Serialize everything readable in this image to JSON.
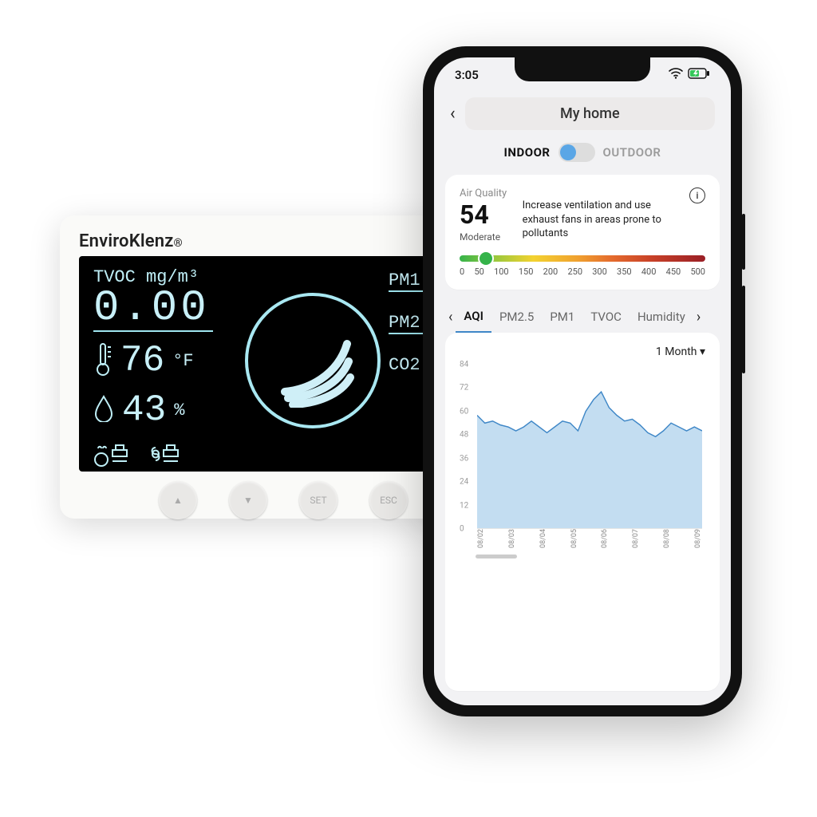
{
  "device": {
    "brand": "EnviroKlenz",
    "tvoc_label": "TVOC mg/m³",
    "tvoc_value": "0.00",
    "temp_value": "76",
    "temp_unit": "°F",
    "hum_value": "43",
    "hum_unit": "%",
    "pm1_label": "PM1.",
    "pm25_label": "PM2.",
    "co2_label": "CO2",
    "buttons": [
      "▲",
      "▼",
      "SET",
      "ESC"
    ]
  },
  "phone": {
    "time": "3:05",
    "title": "My home",
    "segment": {
      "indoor": "INDOOR",
      "outdoor": "OUTDOOR"
    },
    "aq": {
      "label": "Air Quality",
      "value": "54",
      "level": "Moderate",
      "advice": "Increase ventilation and use exhaust fans in areas prone to pollutants"
    },
    "scale_ticks": [
      "0",
      "50",
      "100",
      "150",
      "200",
      "250",
      "300",
      "350",
      "400",
      "450",
      "500"
    ],
    "tabs": [
      "AQI",
      "PM2.5",
      "PM1",
      "TVOC",
      "Humidity"
    ],
    "range_label": "1 Month"
  },
  "chart_data": {
    "type": "area",
    "title": "AQI — 1 Month",
    "xlabel": "",
    "ylabel": "",
    "ylim": [
      0,
      84
    ],
    "yticks": [
      84,
      72,
      60,
      48,
      36,
      24,
      12,
      0
    ],
    "categories": [
      "08/02",
      "08/03",
      "08/04",
      "08/05",
      "08/06",
      "08/07",
      "08/08",
      "08/09"
    ],
    "series": [
      {
        "name": "AQI",
        "values": [
          58,
          54,
          55,
          53,
          52,
          50,
          52,
          55,
          52,
          49,
          52,
          55,
          54,
          50,
          60,
          66,
          70,
          62,
          58,
          55,
          56,
          53,
          49,
          47,
          50,
          54,
          52,
          50,
          52,
          50
        ]
      }
    ]
  }
}
